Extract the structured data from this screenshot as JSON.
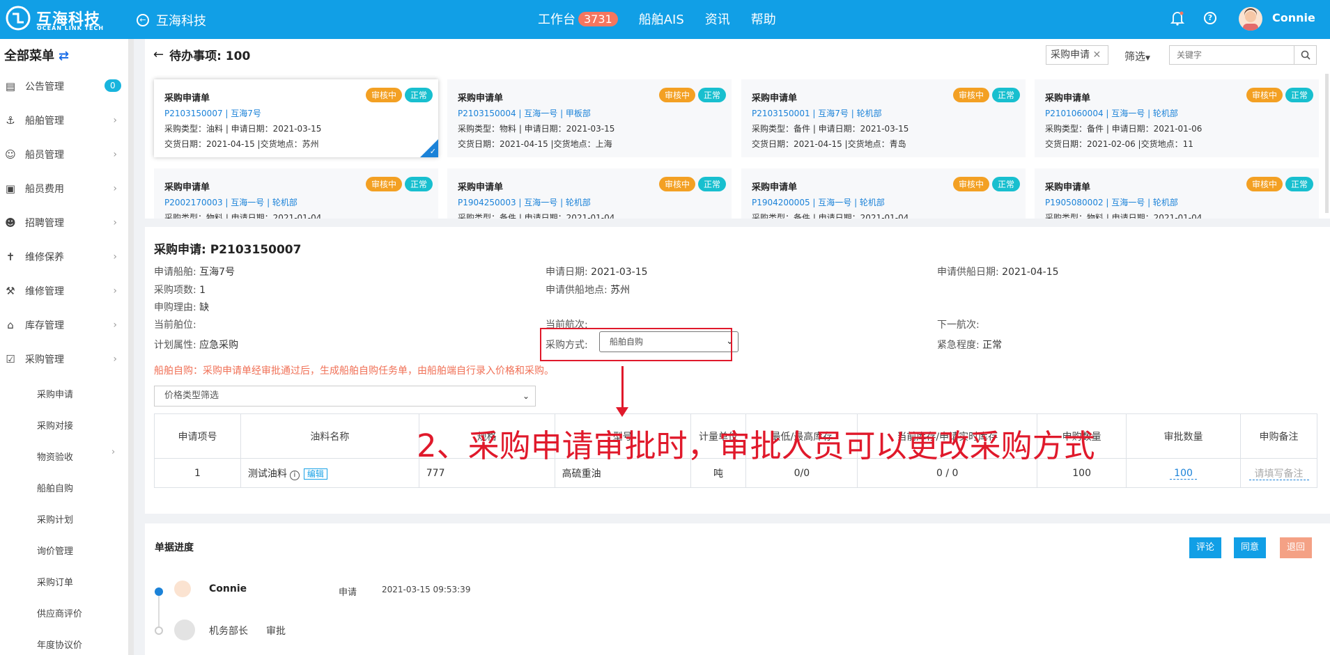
{
  "header": {
    "brand": "互海科技",
    "brand_sub": "OCEAN LINK TECH",
    "company": "互海科技",
    "nav": {
      "workbench": "工作台",
      "workbench_count": "3731",
      "ais": "船舶AIS",
      "news": "资讯",
      "help": "帮助"
    },
    "user": "Connie"
  },
  "sidebar": {
    "title": "全部菜单",
    "items": [
      {
        "label": "公告管理",
        "icon": "book-icon",
        "count": "0"
      },
      {
        "label": "船舶管理",
        "icon": "anchor-icon"
      },
      {
        "label": "船员管理",
        "icon": "person-icon"
      },
      {
        "label": "船员费用",
        "icon": "wallet-icon"
      },
      {
        "label": "招聘管理",
        "icon": "recruit-icon"
      },
      {
        "label": "维修保养",
        "icon": "tool-icon"
      },
      {
        "label": "维修管理",
        "icon": "wrench-icon"
      },
      {
        "label": "库存管理",
        "icon": "home-icon"
      },
      {
        "label": "采购管理",
        "icon": "cart-icon"
      }
    ],
    "sub_items": [
      "采购申请",
      "采购对接",
      "物资验收",
      "船舶自购",
      "采购计划",
      "询价管理",
      "采购订单",
      "供应商评价",
      "年度协议价"
    ]
  },
  "todo": {
    "title": "待办事项: 100",
    "filter_tag": "采购申请",
    "filter_btn": "筛选",
    "search_placeholder": "关键字",
    "cards": [
      {
        "title": "采购申请单",
        "status": "审核中",
        "level": "正常",
        "line1": "P2103150007 | 互海7号",
        "line2": "采购类型：油料 | 申请日期：2021-03-15",
        "line3": "交货日期：2021-04-15 |交货地点：苏州"
      },
      {
        "title": "采购申请单",
        "status": "审核中",
        "level": "正常",
        "line1": "P2103150004 | 互海一号 | 甲板部",
        "line2": "采购类型：物料 | 申请日期：2021-03-15",
        "line3": "交货日期：2021-04-15 |交货地点：上海"
      },
      {
        "title": "采购申请单",
        "status": "审核中",
        "level": "正常",
        "line1": "P2103150001 | 互海7号 | 轮机部",
        "line2": "采购类型：备件 | 申请日期：2021-03-15",
        "line3": "交货日期：2021-04-15 |交货地点：青岛"
      },
      {
        "title": "采购申请单",
        "status": "审核中",
        "level": "正常",
        "line1": "P2101060004 | 互海一号 | 轮机部",
        "line2": "采购类型：备件 | 申请日期：2021-01-06",
        "line3": "交货日期：2021-02-06 |交货地点：11"
      },
      {
        "title": "采购申请单",
        "status": "审核中",
        "level": "正常",
        "line1": "P2002170003 | 互海一号 | 轮机部",
        "line2": "采购类型：物料 | 申请日期：2021-01-04",
        "line3": ""
      },
      {
        "title": "采购申请单",
        "status": "审核中",
        "level": "正常",
        "line1": "P1904250003 | 互海一号 | 轮机部",
        "line2": "采购类型：备件 | 申请日期：2021-01-04",
        "line3": ""
      },
      {
        "title": "采购申请单",
        "status": "审核中",
        "level": "正常",
        "line1": "P1904200005 | 互海一号 | 轮机部",
        "line2": "采购类型：备件 | 申请日期：2021-01-04",
        "line3": ""
      },
      {
        "title": "采购申请单",
        "status": "审核中",
        "level": "正常",
        "line1": "P1905080002 | 互海一号 | 轮机部",
        "line2": "采购类型：物料 | 申请日期：2021-01-04",
        "line3": ""
      }
    ]
  },
  "detail": {
    "title": "采购申请: P2103150007",
    "ship_label": "申请船舶:",
    "ship": "互海7号",
    "date_label": "申请日期:",
    "date": "2021-03-15",
    "supply_date_label": "申请供船日期:",
    "supply_date": "2021-04-15",
    "items_label": "采购项数:",
    "items": "1",
    "place_label": "申请供船地点:",
    "place": "苏州",
    "reason_label": "申购理由:",
    "reason": "缺",
    "berth_label": "当前舶位:",
    "voyage_label": "当前航次:",
    "next_voyage_label": "下一航次:",
    "plan_label": "计划属性:",
    "plan": "应急采购",
    "method_label": "采购方式:",
    "method": "船舶自购",
    "urgency_label": "紧急程度:",
    "urgency": "正常",
    "warning": "船舶自购：采购申请单经审批通过后，生成船舶自购任务单，由船舶端自行录入价格和采购。",
    "price_filter": "价格类型筛选",
    "table": {
      "headers": [
        "申请项号",
        "油料名称",
        "规格",
        "型号",
        "计量单位",
        "最低/最高库存",
        "当前库存/申请实时库存",
        "申购数量",
        "审批数量",
        "申购备注"
      ],
      "rows": [
        {
          "no": "1",
          "name": "测试油料",
          "edit": "编辑",
          "spec": "777",
          "model": "高硫重油",
          "unit": "吨",
          "minmax": "0/0",
          "stock": "0 / 0",
          "qty": "100",
          "approve": "100",
          "note_placeholder": "请填写备注"
        }
      ]
    }
  },
  "annotation": "2、采购申请审批时，审批人员可以更改采购方式",
  "progress": {
    "title": "单据进度",
    "buttons": {
      "comment": "评论",
      "agree": "同意",
      "reject": "退回"
    },
    "steps": [
      {
        "name": "Connie",
        "action": "申请",
        "time": "2021-03-15 09:53:39"
      },
      {
        "name": "机务部长",
        "action": "审批"
      }
    ]
  },
  "colors": {
    "primary": "#119fe6",
    "orange": "#f3a023",
    "teal": "#18bfcf",
    "warn": "#f07056",
    "annot": "#e0192b"
  }
}
